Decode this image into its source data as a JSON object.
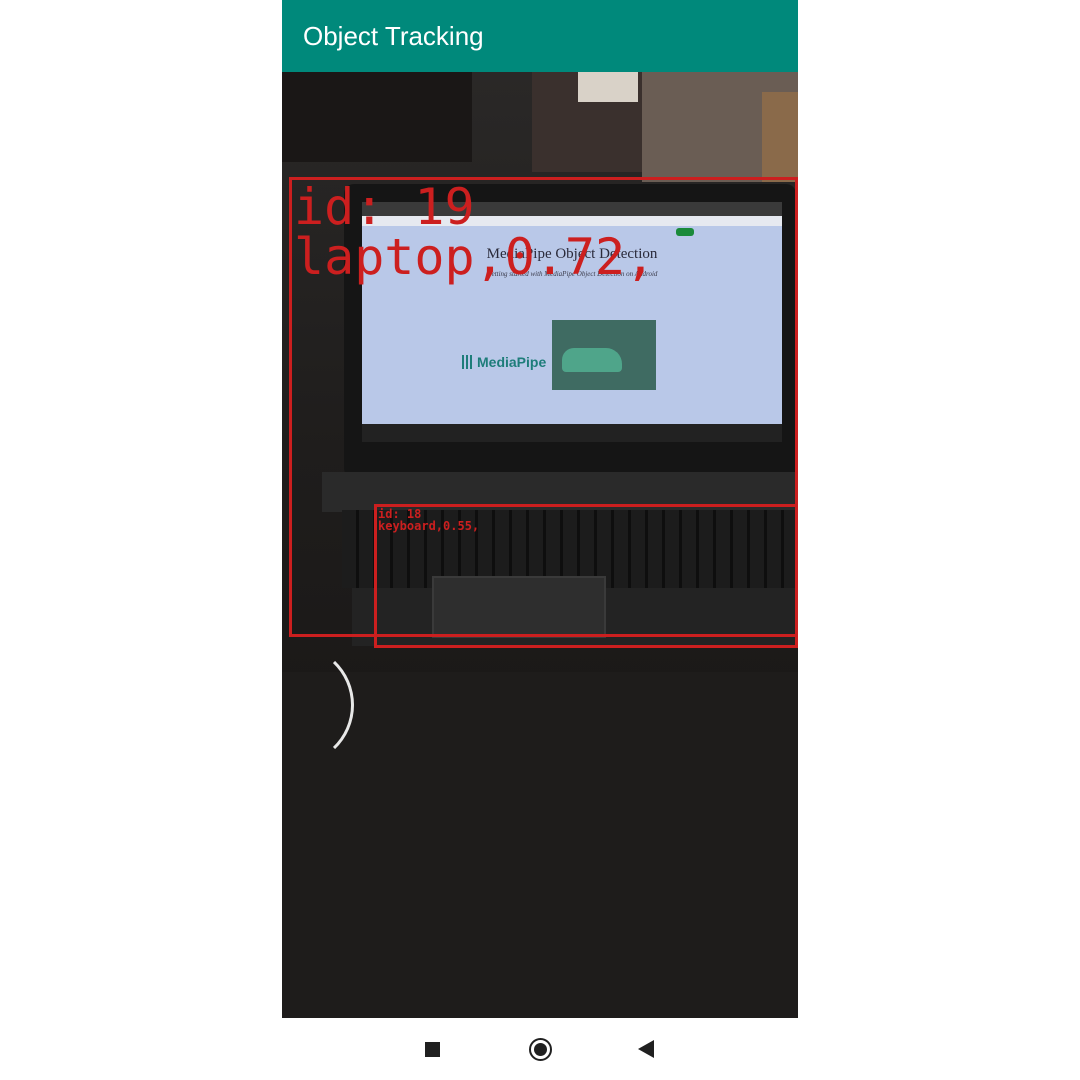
{
  "app_bar": {
    "title": "Object Tracking",
    "color": "#00897b"
  },
  "laptop_screen": {
    "document_title": "MediaPipe Object Detection",
    "document_subtitle": "Getting started with MediaPipe Object Detection on Android",
    "logo_text": "MediaPipe"
  },
  "detections": [
    {
      "id_label": "id: 19",
      "class_label": "laptop,0.72,",
      "color": "#cc1f1f"
    },
    {
      "id_label": "id: 18",
      "class_label": "keyboard,0.55,",
      "color": "#cc1f1f"
    }
  ],
  "nav_bar": {
    "recents_icon": "square-icon",
    "home_icon": "circle-icon",
    "back_icon": "triangle-back-icon"
  }
}
